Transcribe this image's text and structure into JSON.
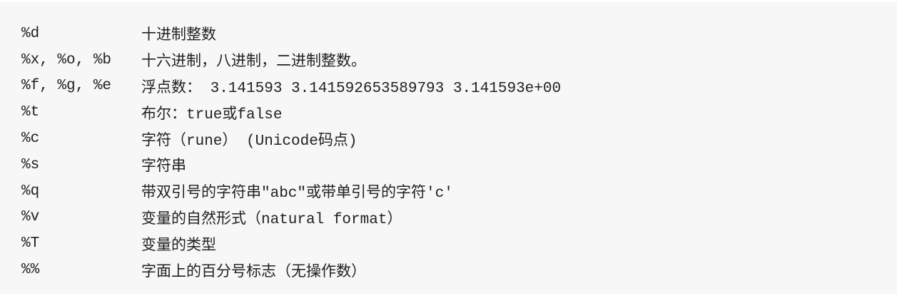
{
  "rows": [
    {
      "verb": "%d",
      "desc": "十进制整数"
    },
    {
      "verb": "%x, %o, %b",
      "desc": "十六进制，八进制，二进制整数。"
    },
    {
      "verb": "%f, %g, %e",
      "desc": "浮点数： 3.141593 3.141592653589793 3.141593e+00"
    },
    {
      "verb": "%t",
      "desc": "布尔：true或false"
    },
    {
      "verb": "%c",
      "desc": "字符（rune） (Unicode码点)"
    },
    {
      "verb": "%s",
      "desc": "字符串"
    },
    {
      "verb": "%q",
      "desc": "带双引号的字符串\"abc\"或带单引号的字符'c'"
    },
    {
      "verb": "%v",
      "desc": "变量的自然形式（natural format）"
    },
    {
      "verb": "%T",
      "desc": "变量的类型"
    },
    {
      "verb": "%%",
      "desc": "字面上的百分号标志（无操作数）"
    }
  ]
}
